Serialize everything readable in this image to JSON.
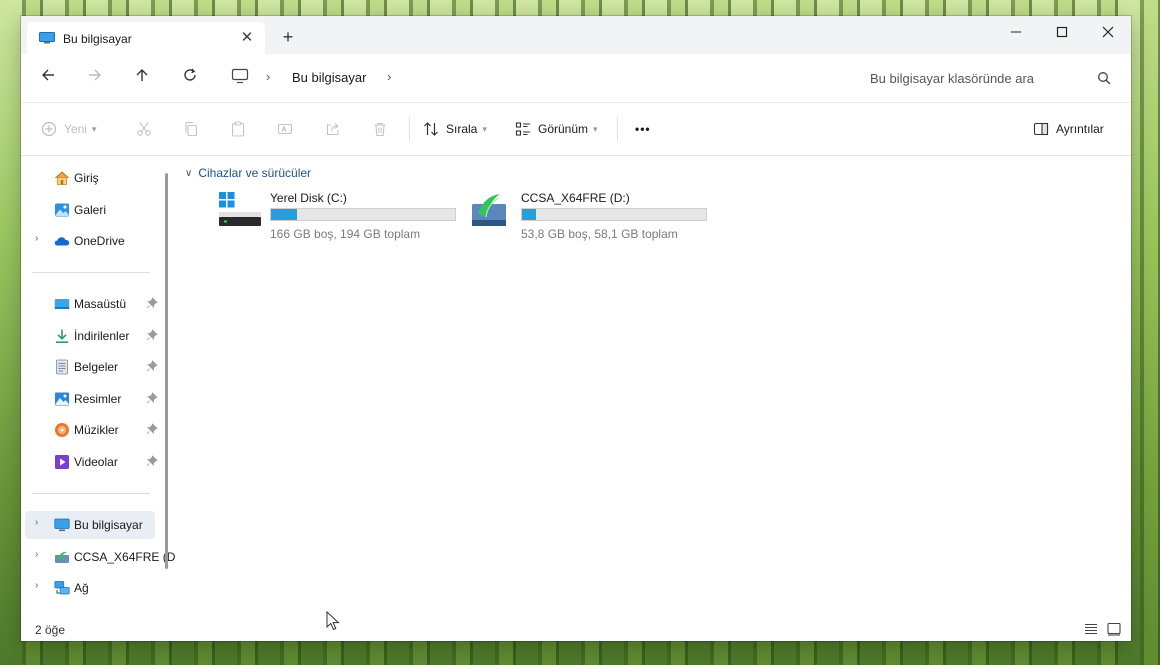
{
  "window": {
    "tab_title": "Bu bilgisayar",
    "new_tab": "+",
    "close_tab": "✕"
  },
  "address": {
    "breadcrumb_sep": "›",
    "location": "Bu bilgisayar",
    "search_placeholder": "Bu bilgisayar klasöründe ara"
  },
  "toolbar": {
    "new_label": "Yeni",
    "sort_label": "Sırala",
    "view_label": "Görünüm",
    "more_label": "•••",
    "details_label": "Ayrıntılar"
  },
  "sidebar": {
    "quick": [
      {
        "label": "Giriş"
      },
      {
        "label": "Galeri"
      },
      {
        "label": "OneDrive"
      }
    ],
    "pinned": [
      {
        "label": "Masaüstü"
      },
      {
        "label": "İndirilenler"
      },
      {
        "label": "Belgeler"
      },
      {
        "label": "Resimler"
      },
      {
        "label": "Müzikler"
      },
      {
        "label": "Videolar"
      }
    ],
    "locations": [
      {
        "label": "Bu bilgisayar"
      },
      {
        "label": "CCSA_X64FRE (D"
      },
      {
        "label": "Ağ"
      }
    ]
  },
  "content": {
    "group_title": "Cihazlar ve sürücüler",
    "drives": [
      {
        "name": "Yerel Disk (C:)",
        "info": "166 GB boş, 194 GB toplam",
        "used_fraction": 0.144
      },
      {
        "name": "CCSA_X64FRE (D:)",
        "info": "53,8 GB boş, 58,1 GB toplam",
        "used_fraction": 0.074
      }
    ]
  },
  "status": {
    "item_count": "2 öğe"
  },
  "colors": {
    "accent": "#26a0da",
    "link": "#1f4e8c"
  }
}
